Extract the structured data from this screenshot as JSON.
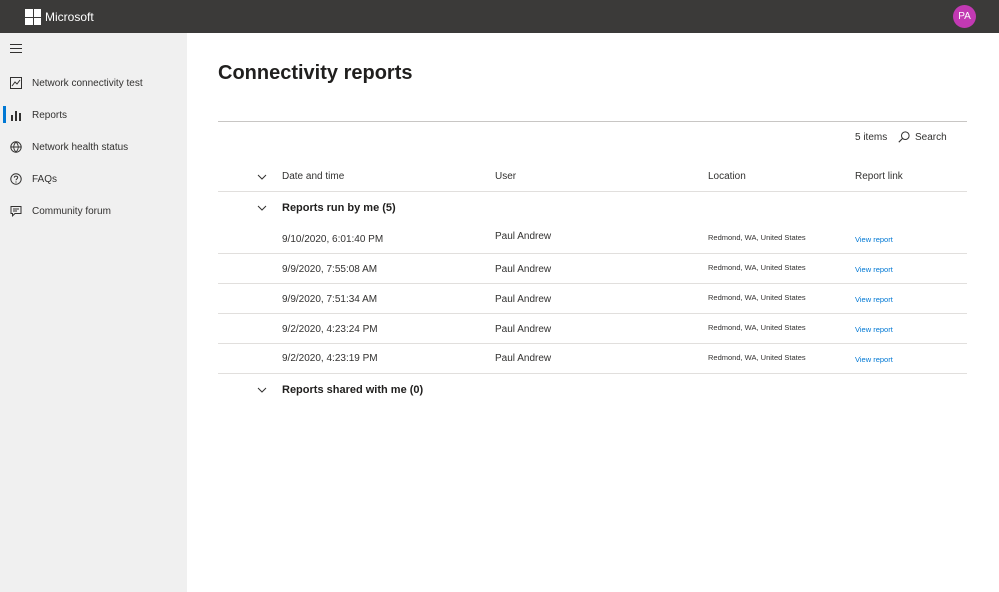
{
  "app": {
    "brand": "Microsoft",
    "user_initials": "PA",
    "avatar_color": "#c239b3",
    "accent_color": "#0078d4"
  },
  "sidebar": {
    "items": [
      {
        "label": "Network connectivity test",
        "icon": "chart-document-icon",
        "active": false
      },
      {
        "label": "Reports",
        "icon": "bar-chart-icon",
        "active": true
      },
      {
        "label": "Network health status",
        "icon": "network-globe-icon",
        "active": false
      },
      {
        "label": "FAQs",
        "icon": "help-circle-icon",
        "active": false
      },
      {
        "label": "Community forum",
        "icon": "chat-icon",
        "active": false
      }
    ]
  },
  "main": {
    "title": "Connectivity reports",
    "items_count": "5 items",
    "search_label": "Search",
    "columns": [
      "Date and time",
      "User",
      "Location",
      "Report link"
    ],
    "groups": [
      {
        "label": "Reports run by me (5)",
        "rows": [
          {
            "date": "9/10/2020, 6:01:40 PM",
            "user": "Paul Andrew",
            "location": "Redmond, WA, United States",
            "link": "View report"
          },
          {
            "date": "9/9/2020, 7:55:08 AM",
            "user": "Paul Andrew",
            "location": "Redmond, WA, United States",
            "link": "View report"
          },
          {
            "date": "9/9/2020, 7:51:34 AM",
            "user": "Paul Andrew",
            "location": "Redmond, WA, United States",
            "link": "View report"
          },
          {
            "date": "9/2/2020, 4:23:24 PM",
            "user": "Paul Andrew",
            "location": "Redmond, WA, United States",
            "link": "View report"
          },
          {
            "date": "9/2/2020, 4:23:19 PM",
            "user": "Paul Andrew",
            "location": "Redmond, WA, United States",
            "link": "View report"
          }
        ]
      },
      {
        "label": "Reports shared with me (0)",
        "rows": []
      }
    ]
  }
}
